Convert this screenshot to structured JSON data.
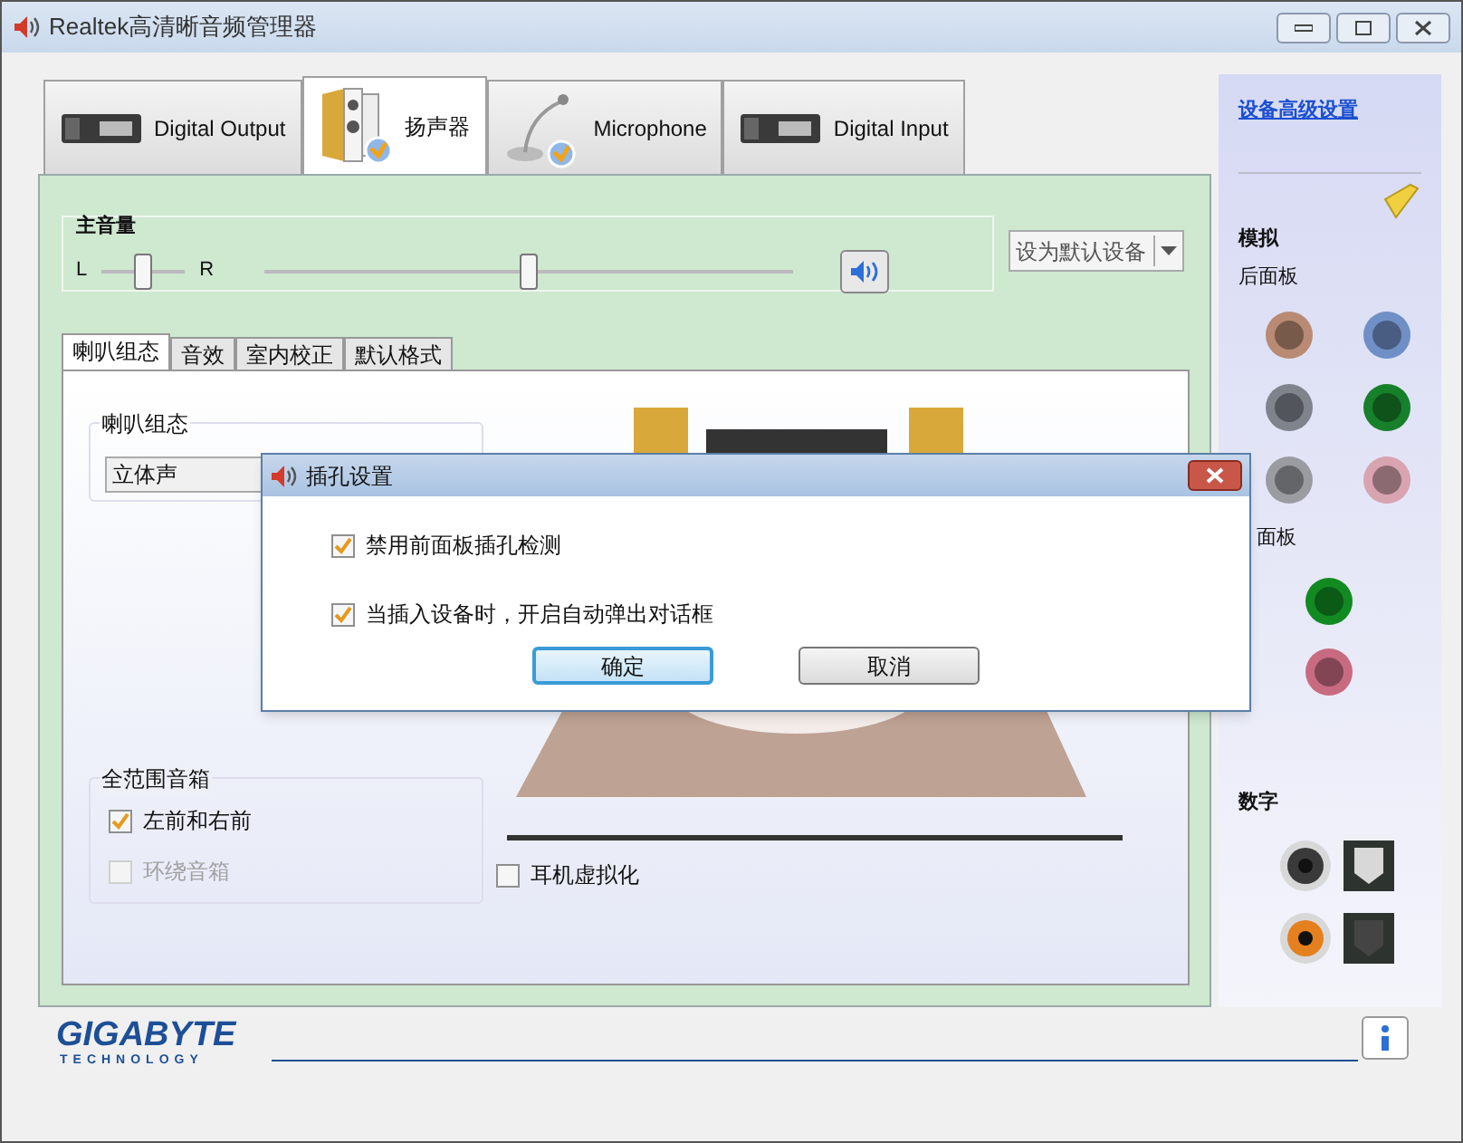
{
  "window": {
    "title": "Realtek高清晰音频管理器"
  },
  "device_tabs": [
    {
      "label": "Digital Output",
      "selected": false,
      "kind": "rack"
    },
    {
      "label": "扬声器",
      "selected": true,
      "kind": "speaker"
    },
    {
      "label": "Microphone",
      "selected": false,
      "kind": "mic"
    },
    {
      "label": "Digital Input",
      "selected": false,
      "kind": "rack"
    }
  ],
  "main_volume": {
    "title": "主音量",
    "left_label": "L",
    "right_label": "R",
    "balance": {
      "level": 0.5
    },
    "volume": {
      "level": 0.5
    }
  },
  "default_device": {
    "value": "设为默认设备"
  },
  "sub_tabs": [
    {
      "label": "喇叭组态",
      "selected": true
    },
    {
      "label": "音效",
      "selected": false
    },
    {
      "label": "室内校正",
      "selected": false
    },
    {
      "label": "默认格式",
      "selected": false
    }
  ],
  "speaker_config": {
    "title": "喇叭组态",
    "value": "立体声"
  },
  "full_range": {
    "title": "全范围音箱",
    "items": [
      {
        "label": "左前和右前",
        "checked": true,
        "disabled": false
      },
      {
        "label": "环绕音箱",
        "checked": false,
        "disabled": true
      }
    ]
  },
  "headphone_virtualization": {
    "label": "耳机虚拟化",
    "checked": false
  },
  "side_panel": {
    "link": "设备高级设置",
    "analog_title": "模拟",
    "rear_title": "后面板",
    "rear_jacks": [
      {
        "color": "#b98a74"
      },
      {
        "color": "#6f8fc6"
      },
      {
        "color": "#7f838c"
      },
      {
        "color": "#17802a"
      },
      {
        "color": "#9a9ca2"
      },
      {
        "color": "#d7a4b0"
      }
    ],
    "front_title": "面板",
    "front_jacks": [
      {
        "color": "#128a22"
      },
      {
        "color": "#c86b80"
      }
    ],
    "digital_title": "数字",
    "digital_ports": [
      {
        "color": "#3a3a3a"
      },
      {
        "color": "#e5801e"
      }
    ]
  },
  "branding": {
    "name": "GIGABYTE",
    "tagline": "TECHNOLOGY"
  },
  "dialog": {
    "title": "插孔设置",
    "options": [
      {
        "label": "禁用前面板插孔检测",
        "checked": true
      },
      {
        "label": "当插入设备时，开启自动弹出对话框",
        "checked": true
      }
    ],
    "buttons": [
      {
        "label": "确定",
        "default": true
      },
      {
        "label": "取消",
        "default": false
      }
    ]
  }
}
